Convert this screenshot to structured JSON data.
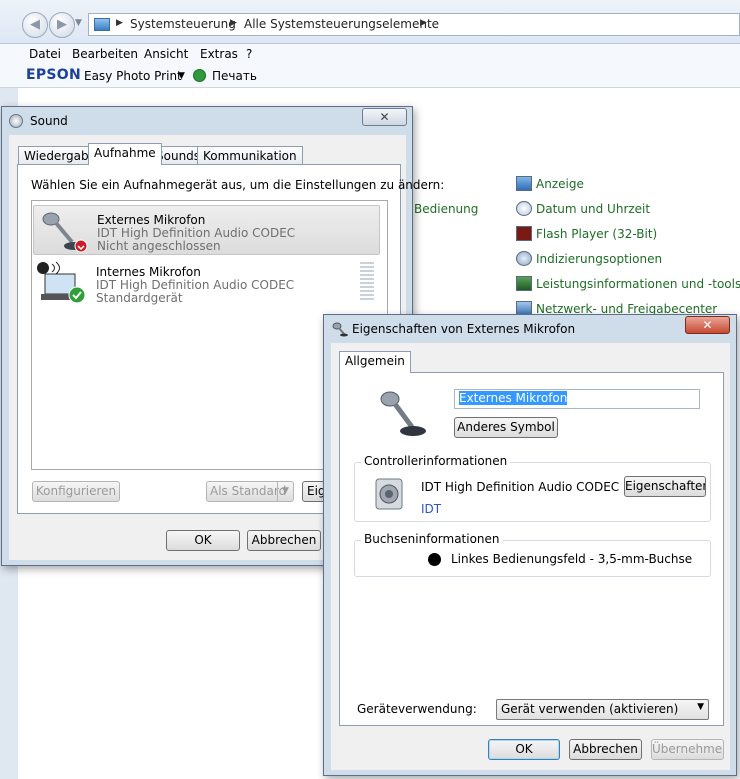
{
  "explorer": {
    "breadcrumb": [
      "Systemsteuerung",
      "Alle Systemsteuerungselemente"
    ],
    "menu": [
      "Datei",
      "Bearbeiten",
      "Ansicht",
      "Extras",
      "?"
    ],
    "epson": {
      "logo": "EPSON",
      "app": "Easy Photo Print",
      "print": "Печать"
    },
    "partial_link": "Bedienung",
    "cp_items": [
      "Anzeige",
      "Datum und Uhrzeit",
      "Flash Player (32-Bit)",
      "Indizierungsoptionen",
      "Leistungsinformationen und -tools",
      "Netzwerk- und Freigabecenter"
    ]
  },
  "sound_dialog": {
    "title": "Sound",
    "tabs": [
      "Wiedergabe",
      "Aufnahme",
      "Sounds",
      "Kommunikation"
    ],
    "active_tab": "Aufnahme",
    "instruction": "Wählen Sie ein Aufnahmegerät aus, um die Einstellungen zu ändern:",
    "devices": [
      {
        "name": "Externes Mikrofon",
        "driver": "IDT High Definition Audio CODEC",
        "status": "Nicht angeschlossen"
      },
      {
        "name": "Internes Mikrofon",
        "driver": "IDT High Definition Audio CODEC",
        "status": "Standardgerät"
      }
    ],
    "buttons": {
      "configure": "Konfigurieren",
      "set_default": "Als Standard",
      "properties_partial": "Eig",
      "ok": "OK",
      "cancel": "Abbrechen"
    }
  },
  "properties_dialog": {
    "title": "Eigenschaften von Externes Mikrofon",
    "tab": "Allgemein",
    "device_name_value": "Externes Mikrofon",
    "change_icon_button": "Anderes Symbol",
    "controller": {
      "label": "Controllerinformationen",
      "name": "IDT High Definition Audio CODEC",
      "vendor": "IDT",
      "properties_button": "Eigenschaften"
    },
    "jack": {
      "label": "Buchseninformationen",
      "text": "Linkes Bedienungsfeld - 3,5-mm-Buchse"
    },
    "usage": {
      "label": "Geräteverwendung:",
      "selected": "Gerät verwenden (aktivieren)"
    },
    "buttons": {
      "ok": "OK",
      "cancel": "Abbrechen",
      "apply": "Übernehmen"
    }
  },
  "colors": {
    "link_green": "#1e6d26",
    "selection_blue": "#3399ff",
    "close_red": "#c64a33"
  }
}
